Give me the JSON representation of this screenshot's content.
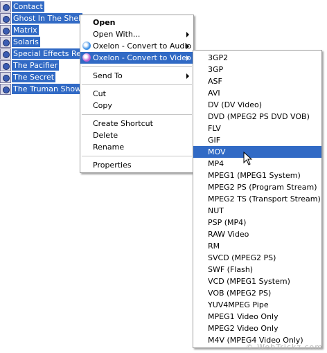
{
  "files": [
    {
      "name": "Contact"
    },
    {
      "name": "Ghost In The Shell.m"
    },
    {
      "name": "Matrix"
    },
    {
      "name": "Solaris"
    },
    {
      "name": "Special Effects Rese"
    },
    {
      "name": "The Pacifier"
    },
    {
      "name": "The Secret"
    },
    {
      "name": "The Truman Show"
    }
  ],
  "context_menu": {
    "items": [
      {
        "label": "Open"
      },
      {
        "label": "Open With..."
      },
      {
        "label": "Oxelon - Convert to Audio"
      },
      {
        "label": "Oxelon - Convert to Video"
      },
      {
        "label": "Send To"
      },
      {
        "label": "Cut"
      },
      {
        "label": "Copy"
      },
      {
        "label": "Create Shortcut"
      },
      {
        "label": "Delete"
      },
      {
        "label": "Rename"
      },
      {
        "label": "Properties"
      }
    ]
  },
  "submenu": {
    "items": [
      "3GP2",
      "3GP",
      "ASF",
      "AVI",
      "DV (DV Video)",
      "DVD (MPEG2 PS DVD VOB)",
      "FLV",
      "GIF",
      "MOV",
      "MP4",
      "MPEG1 (MPEG1 System)",
      "MPEG2 PS (Program Stream)",
      "MPEG2 TS (Transport Stream)",
      "NUT",
      "PSP (MP4)",
      "RAW Video",
      "RM",
      "SVCD (MPEG2 PS)",
      "SWF (Flash)",
      "VCD (MPEG1 System)",
      "VOB (MPEG2 PS)",
      "YUV4MPEG Pipe",
      "MPEG1 Video Only",
      "MPEG2 Video Only",
      "M4V (MPEG4 Video Only)"
    ],
    "highlighted": "MOV"
  },
  "watermark": "© WebTrickz.com",
  "colors": {
    "selection": "#316ac5",
    "menu_bg": "#ffffff",
    "oxelon_audio_icon": "#3a8ee6",
    "oxelon_video_icon": "#c060d0"
  }
}
